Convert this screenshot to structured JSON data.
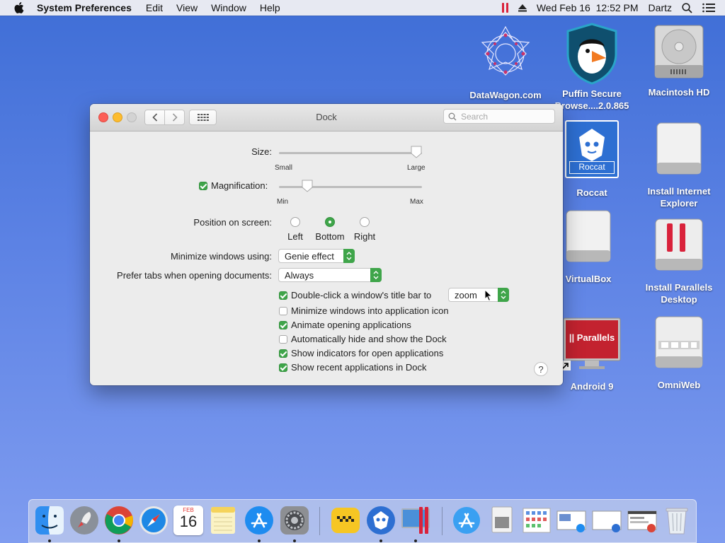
{
  "menubar": {
    "app_name": "System Preferences",
    "items": [
      "Edit",
      "View",
      "Window",
      "Help"
    ],
    "clock": "Wed Feb 16  12:52 PM",
    "user": "Dartz"
  },
  "desktop": {
    "icons": [
      {
        "label": "DataWagon.com"
      },
      {
        "label": "Puffin Secure Browse....2.0.865"
      },
      {
        "label": "Macintosh HD"
      },
      {
        "label": "Roccat",
        "badge": "Roccat"
      },
      {
        "label": "Install Internet Explorer"
      },
      {
        "label": "VirtualBox"
      },
      {
        "label": "Install Parallels Desktop"
      },
      {
        "label": "Android 9",
        "badge": "|| Parallels"
      },
      {
        "label": "OmniWeb"
      }
    ]
  },
  "window": {
    "title": "Dock",
    "search_placeholder": "Search",
    "size": {
      "label": "Size:",
      "min_label": "Small",
      "max_label": "Large",
      "value": 1.0
    },
    "magnification": {
      "label": "Magnification:",
      "checked": true,
      "min_label": "Min",
      "max_label": "Max",
      "value": 0.17
    },
    "position": {
      "label": "Position on screen:",
      "options": [
        "Left",
        "Bottom",
        "Right"
      ],
      "selected": "Bottom"
    },
    "minimize_using": {
      "label": "Minimize windows using:",
      "value": "Genie effect"
    },
    "prefer_tabs": {
      "label": "Prefer tabs when opening documents:",
      "value": "Always"
    },
    "double_click": {
      "label": "Double-click a window's title bar to",
      "checked": true,
      "value": "zoom"
    },
    "checkboxes": [
      {
        "label": "Minimize windows into application icon",
        "checked": false
      },
      {
        "label": "Animate opening applications",
        "checked": true
      },
      {
        "label": "Automatically hide and show the Dock",
        "checked": false
      },
      {
        "label": "Show indicators for open applications",
        "checked": true
      },
      {
        "label": "Show recent applications in Dock",
        "checked": true
      }
    ],
    "help": "?"
  },
  "dock": {
    "calendar_month": "FEB",
    "calendar_day": "16"
  },
  "colors": {
    "accent": "#3fa54a",
    "desktop": "#5c82e4"
  }
}
